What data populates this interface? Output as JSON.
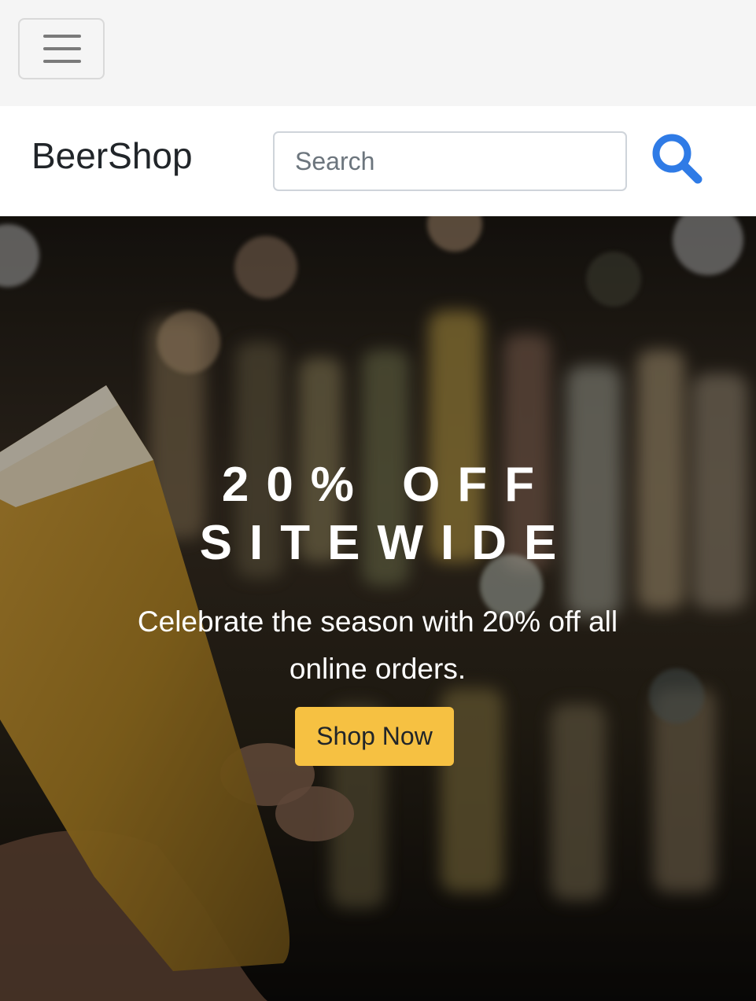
{
  "navbar": {
    "toggle_icon": "hamburger-menu-icon"
  },
  "header": {
    "brand": "BeerShop",
    "search": {
      "placeholder": "Search",
      "value": "",
      "button_icon": "search-icon",
      "icon_color": "#2f7be6"
    }
  },
  "hero": {
    "title_line1": "20% OFF",
    "title_line2": "SITEWIDE",
    "subtitle": "Celebrate the season with 20% off all online orders.",
    "cta_label": "Shop Now",
    "cta_color": "#f6c142",
    "background_image": "beer-glass-toast-bar-photo"
  }
}
